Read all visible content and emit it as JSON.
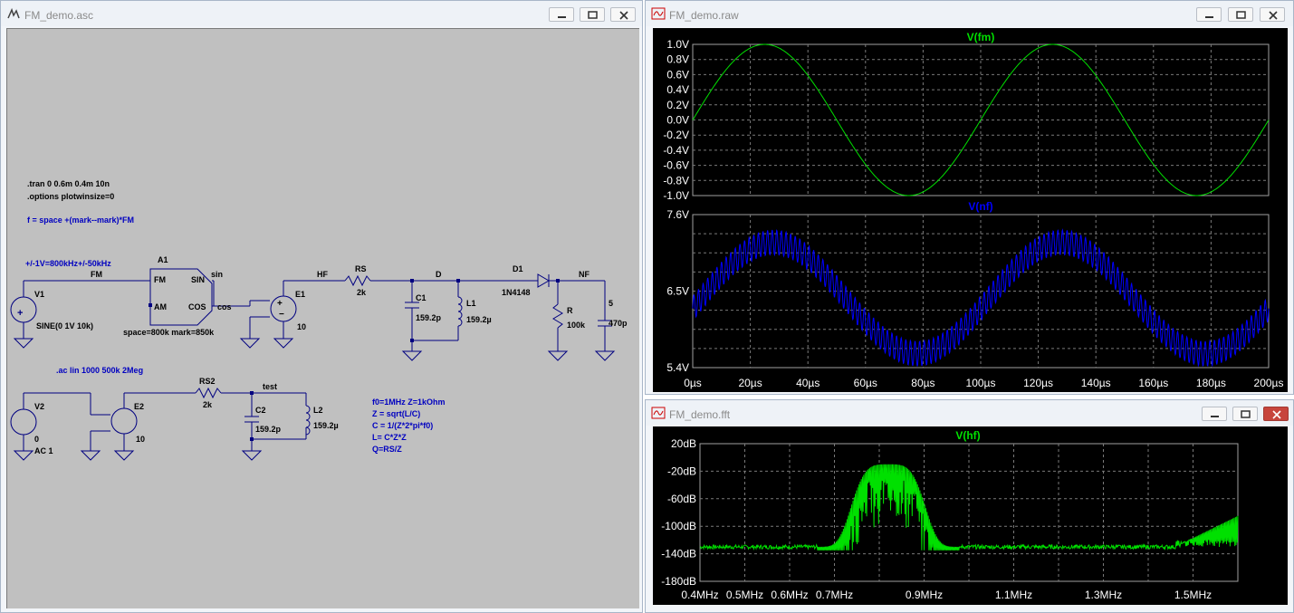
{
  "schematic": {
    "title": "FM_demo.asc",
    "directives": {
      "tran": ".tran 0 0.6m 0.4m 10n",
      "options": ".options plotwinsize=0",
      "ac": ".ac lin 1000 500k  2Meg"
    },
    "func": "f = space +(mark--mark)*FM",
    "v1": {
      "note": "+/-1V=800kHz+/-50kHz",
      "name": "V1",
      "value": "SINE(0 1V 10k)"
    },
    "a1": {
      "name": "A1",
      "pin_fm": "FM",
      "pin_am": "AM",
      "pin_sin": "SIN",
      "pin_cos": "COS",
      "params": "space=800k mark=850k"
    },
    "nets": {
      "fm": "FM",
      "sin": "sin",
      "cos": "cos",
      "hf": "HF",
      "d": "D",
      "nf": "NF",
      "test": "test"
    },
    "e1": {
      "name": "E1",
      "gain": "10"
    },
    "rs": {
      "name": "RS",
      "value": "2k"
    },
    "c1": {
      "name": "C1",
      "value": "159.2p"
    },
    "l1": {
      "name": "L1",
      "value": "159.2µ"
    },
    "d1": {
      "name": "D1",
      "model": "1N4148"
    },
    "r": {
      "name": "R",
      "value": "100k"
    },
    "cnf": {
      "name": "5",
      "value": "470p"
    },
    "v2": {
      "name": "V2",
      "value1": "0",
      "value2": "AC 1"
    },
    "e2": {
      "name": "E2",
      "gain": "10"
    },
    "rs2": {
      "name": "RS2",
      "value": "2k"
    },
    "c2": {
      "name": "C2",
      "value": "159.2p"
    },
    "l2": {
      "name": "L2",
      "value": "159.2µ"
    },
    "notes": [
      "f0=1MHz Z=1kOhm",
      "Z = sqrt(L/C)",
      "C = 1/(Z*2*pi*f0)",
      "L= C*Z*Z",
      "Q=RS/Z"
    ]
  },
  "raw_window": {
    "title": "FM_demo.raw",
    "panes": [
      {
        "trace": "V(fm)",
        "color": "#00e000",
        "yticks": [
          "1.0V",
          "0.8V",
          "0.6V",
          "0.4V",
          "0.2V",
          "0.0V",
          "-0.2V",
          "-0.4V",
          "-0.6V",
          "-0.8V",
          "-1.0V"
        ]
      },
      {
        "trace": "V(nf)",
        "color": "#0000ff",
        "yticks": [
          "7.6V",
          "6.5V",
          "5.4V"
        ]
      }
    ],
    "xticks": [
      "0µs",
      "20µs",
      "40µs",
      "60µs",
      "80µs",
      "100µs",
      "120µs",
      "140µs",
      "160µs",
      "180µs",
      "200µs"
    ]
  },
  "fft_window": {
    "title": "FM_demo.fft",
    "trace": "V(hf)",
    "color": "#00e000",
    "yticks": [
      "20dB",
      "-20dB",
      "-60dB",
      "-100dB",
      "-140dB",
      "-180dB"
    ],
    "xticks": [
      "0.4MHz",
      "0.5MHz",
      "0.6MHz",
      "0.7MHz",
      "0.9MHz",
      "1.1MHz",
      "1.3MHz",
      "1.5MHz"
    ]
  },
  "chart_data": [
    {
      "type": "line",
      "title": "V(fm)",
      "x_unit": "µs",
      "xlim": [
        0,
        200
      ],
      "ylim": [
        -1.0,
        1.0
      ],
      "grid": true,
      "series": [
        {
          "name": "V(fm)",
          "x": [
            0,
            25,
            50,
            75,
            100,
            125,
            150,
            175,
            200
          ],
          "y": [
            0.0,
            1.0,
            0.0,
            -1.0,
            0.0,
            1.0,
            0.0,
            -1.0,
            0.0
          ]
        }
      ]
    },
    {
      "type": "line",
      "title": "V(nf)",
      "x_unit": "µs",
      "xlim": [
        0,
        200
      ],
      "ylim": [
        5.4,
        7.6
      ],
      "grid": true,
      "series": [
        {
          "name": "V(nf)",
          "x": [
            0,
            28,
            78,
            128,
            178,
            200
          ],
          "y": [
            6.4,
            7.2,
            5.6,
            7.2,
            5.6,
            6.5
          ]
        }
      ]
    },
    {
      "type": "line",
      "title": "V(hf)",
      "x_unit": "MHz",
      "xlim": [
        0.4,
        1.6
      ],
      "ylim": [
        -180,
        20
      ],
      "grid": true,
      "series": [
        {
          "name": "V(hf)",
          "x": [
            0.4,
            0.6,
            0.68,
            0.75,
            0.8,
            0.85,
            0.9,
            0.95,
            1.0,
            1.2,
            1.4,
            1.5,
            1.6
          ],
          "y": [
            -130,
            -130,
            -125,
            -60,
            -20,
            -20,
            -20,
            -60,
            -130,
            -130,
            -130,
            -110,
            -100
          ]
        }
      ]
    }
  ]
}
